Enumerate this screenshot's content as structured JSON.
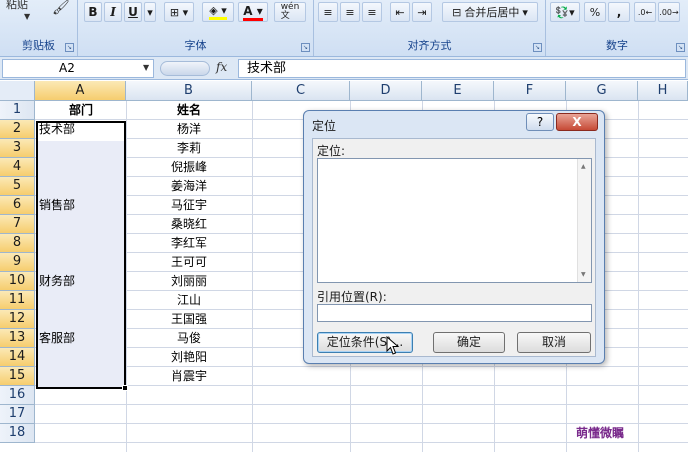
{
  "ribbon": {
    "paste_label": "粘贴",
    "groups": [
      {
        "label": "剪贴板"
      },
      {
        "label": "字体"
      },
      {
        "label": "对齐方式"
      },
      {
        "label": "数字"
      }
    ],
    "font_buttons": {
      "bold": "B",
      "italic": "I",
      "underline": "U"
    },
    "wen_label": "wén\n文",
    "merge_label": "合并后居中",
    "percent_label": "%",
    "comma_label": ","
  },
  "formula_bar": {
    "name_box": "A2",
    "fx": "fx",
    "content": "技术部"
  },
  "columns": [
    "A",
    "B",
    "C",
    "D",
    "E",
    "F",
    "G",
    "H"
  ],
  "rows": [
    "1",
    "2",
    "3",
    "4",
    "5",
    "6",
    "7",
    "8",
    "9",
    "10",
    "11",
    "12",
    "13",
    "14",
    "15",
    "16",
    "17",
    "18"
  ],
  "sheet": {
    "header": {
      "dept": "部门",
      "name": "姓名"
    },
    "depts": [
      {
        "row": 2,
        "text": "技术部"
      },
      {
        "row": 6,
        "text": "销售部"
      },
      {
        "row": 10,
        "text": "财务部"
      },
      {
        "row": 13,
        "text": "客服部"
      }
    ],
    "names": [
      "杨洋",
      "李莉",
      "倪振峰",
      "姜海洋",
      "马征宇",
      "桑晓红",
      "李红军",
      "王可可",
      "刘丽丽",
      "江山",
      "王国强",
      "马俊",
      "刘艳阳",
      "肖震宇"
    ]
  },
  "dialog": {
    "title": "定位",
    "help": "?",
    "close": "X",
    "goto_label": "定位:",
    "ref_label": "引用位置(R):",
    "special_button": "定位条件(S)...",
    "ok_button": "确定",
    "cancel_button": "取消"
  },
  "watermark": "萌懂微瞩"
}
